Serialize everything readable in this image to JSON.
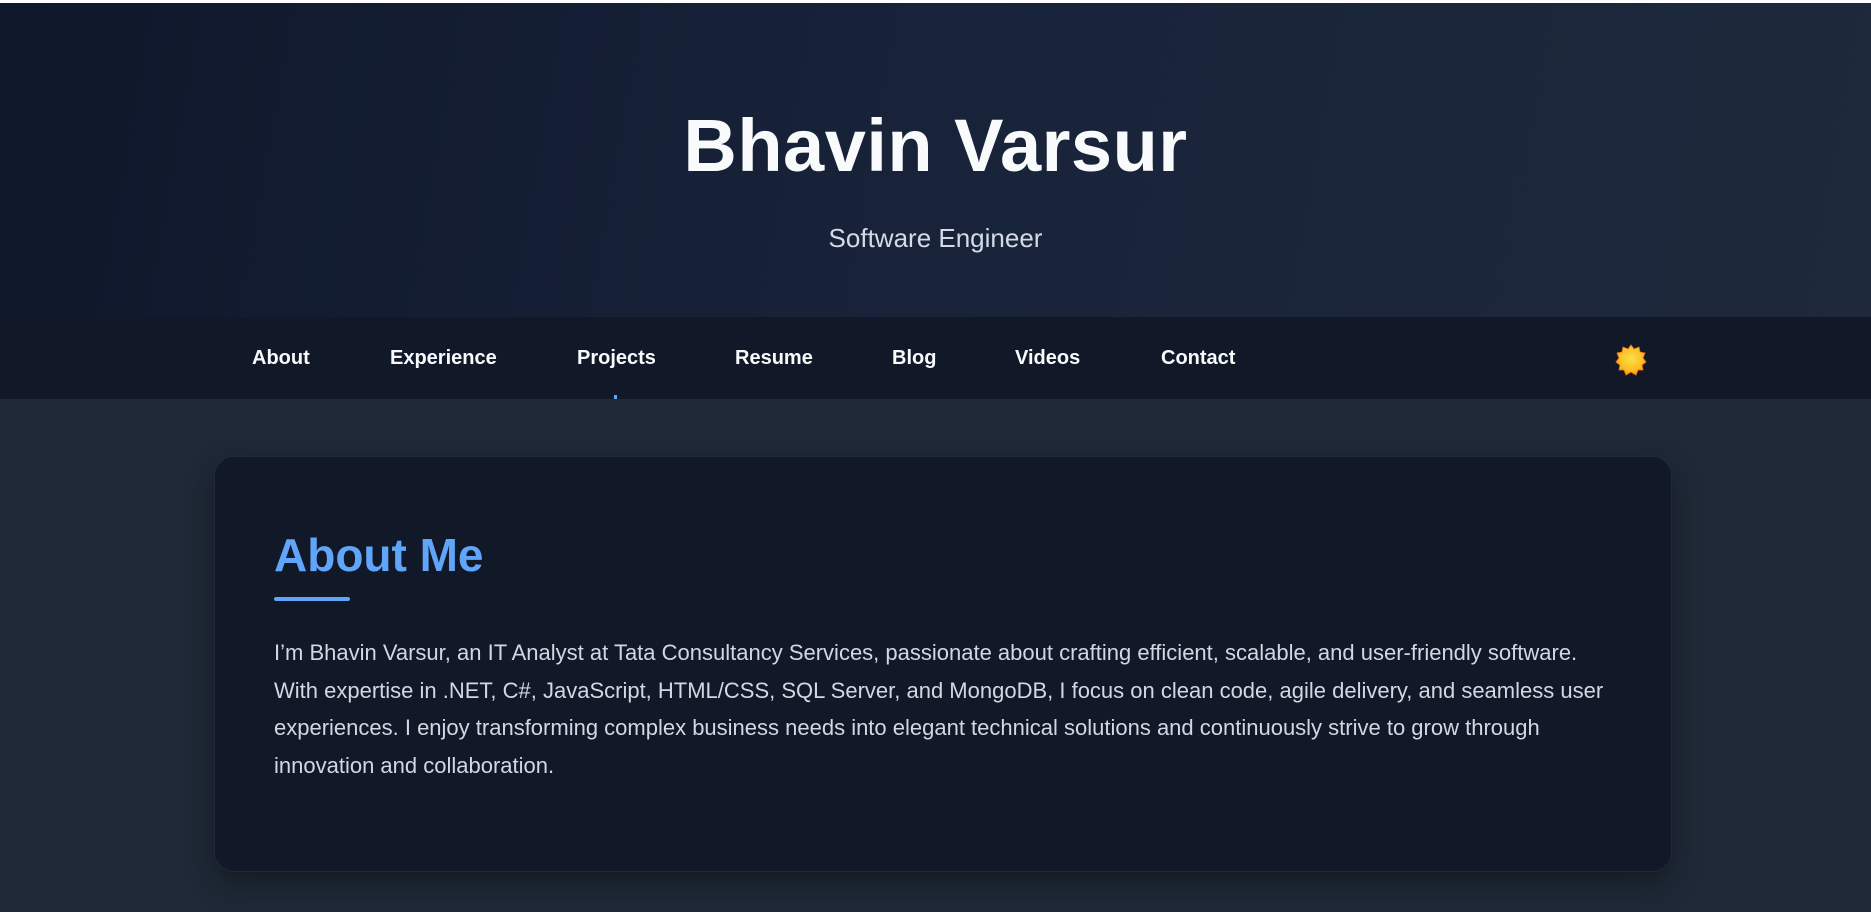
{
  "hero": {
    "name": "Bhavin Varsur",
    "title": "Software Engineer"
  },
  "nav": {
    "items": [
      {
        "label": "About"
      },
      {
        "label": "Experience"
      },
      {
        "label": "Projects"
      },
      {
        "label": "Resume"
      },
      {
        "label": "Blog"
      },
      {
        "label": "Videos"
      },
      {
        "label": "Contact"
      }
    ],
    "theme_toggle_icon": "sun-icon"
  },
  "about": {
    "heading": "About Me",
    "body": "I’m Bhavin Varsur, an IT Analyst at Tata Consultancy Services, passionate about crafting efficient, scalable, and user-friendly software. With expertise in .NET, C#, JavaScript, HTML/CSS, SQL Server, and MongoDB, I focus on clean code, agile delivery, and seamless user experiences. I enjoy transforming complex business needs into elegant technical solutions and continuously strive to grow through innovation and collaboration."
  },
  "colors": {
    "accent": "#60a5fa",
    "hero_bg": "#0f172a",
    "nav_bg": "#111827",
    "page_bg": "#1f2937",
    "card_bg": "#111827",
    "sun": "#fbbf24"
  }
}
